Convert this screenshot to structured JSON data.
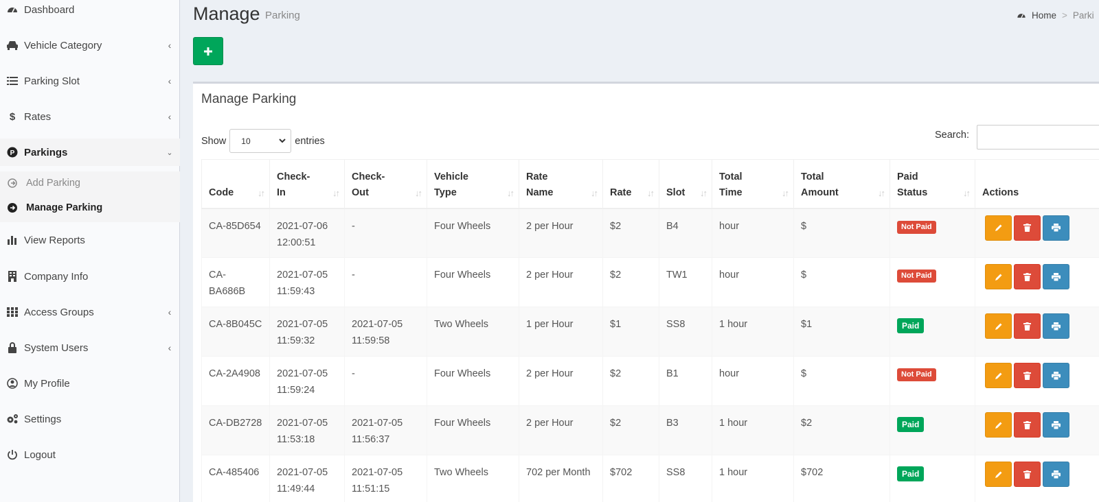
{
  "sidebar": {
    "items": [
      {
        "label": "Dashboard",
        "icon": "dashboard-icon"
      },
      {
        "label": "Vehicle Category",
        "icon": "car-icon"
      },
      {
        "label": "Parking Slot",
        "icon": "list-icon"
      },
      {
        "label": "Rates",
        "icon": "dollar-icon"
      },
      {
        "label": "Parkings",
        "icon": "parking-icon"
      },
      {
        "label": "View Reports",
        "icon": "bar-chart-icon"
      },
      {
        "label": "Company Info",
        "icon": "building-icon"
      },
      {
        "label": "Access Groups",
        "icon": "grid-icon"
      },
      {
        "label": "System Users",
        "icon": "lock-icon"
      },
      {
        "label": "My Profile",
        "icon": "user-circle-icon"
      },
      {
        "label": "Settings",
        "icon": "gears-icon"
      },
      {
        "label": "Logout",
        "icon": "power-icon"
      }
    ],
    "submenu": [
      {
        "label": "Add Parking"
      },
      {
        "label": "Manage Parking"
      }
    ]
  },
  "header": {
    "title": "Manage",
    "subtitle": "Parking",
    "breadcrumb": {
      "home": "Home",
      "separator": ">",
      "current": "Parki"
    }
  },
  "box": {
    "title": "Manage Parking",
    "show_label": "Show",
    "page_length": "10",
    "entries_label": "entries",
    "search_label": "Search:",
    "search_value": ""
  },
  "table": {
    "headers": [
      {
        "line1": "",
        "line2": "Code"
      },
      {
        "line1": "Check-",
        "line2": "In"
      },
      {
        "line1": "Check-",
        "line2": "Out"
      },
      {
        "line1": "Vehicle",
        "line2": "Type"
      },
      {
        "line1": "Rate",
        "line2": "Name"
      },
      {
        "line1": "",
        "line2": "Rate"
      },
      {
        "line1": "",
        "line2": "Slot"
      },
      {
        "line1": "Total",
        "line2": "Time"
      },
      {
        "line1": "Total",
        "line2": "Amount"
      },
      {
        "line1": "Paid",
        "line2": "Status"
      },
      {
        "line1": "",
        "line2": "Actions"
      }
    ],
    "rows": [
      {
        "code": "CA-85D654",
        "in1": "2021-07-06",
        "in2": "12:00:51",
        "out1": "-",
        "out2": "",
        "vehicle": "Four Wheels",
        "rate_name": "2 per Hour",
        "rate": "$2",
        "slot": "B4",
        "time": "hour",
        "amount": "$",
        "status": "Not Paid"
      },
      {
        "code": "CA-BA686B",
        "in1": "2021-07-05",
        "in2": "11:59:43",
        "out1": "-",
        "out2": "",
        "vehicle": "Four Wheels",
        "rate_name": "2 per Hour",
        "rate": "$2",
        "slot": "TW1",
        "time": "hour",
        "amount": "$",
        "status": "Not Paid"
      },
      {
        "code": "CA-8B045C",
        "in1": "2021-07-05",
        "in2": "11:59:32",
        "out1": "2021-07-05",
        "out2": "11:59:58",
        "vehicle": "Two Wheels",
        "rate_name": "1 per Hour",
        "rate": "$1",
        "slot": "SS8",
        "time": "1 hour",
        "amount": "$1",
        "status": "Paid"
      },
      {
        "code": "CA-2A4908",
        "in1": "2021-07-05",
        "in2": "11:59:24",
        "out1": "-",
        "out2": "",
        "vehicle": "Four Wheels",
        "rate_name": "2 per Hour",
        "rate": "$2",
        "slot": "B1",
        "time": "hour",
        "amount": "$",
        "status": "Not Paid"
      },
      {
        "code": "CA-DB2728",
        "in1": "2021-07-05",
        "in2": "11:53:18",
        "out1": "2021-07-05",
        "out2": "11:56:37",
        "vehicle": "Four Wheels",
        "rate_name": "2 per Hour",
        "rate": "$2",
        "slot": "B3",
        "time": "1 hour",
        "amount": "$2",
        "status": "Paid"
      },
      {
        "code": "CA-485406",
        "in1": "2021-07-05",
        "in2": "11:49:44",
        "out1": "2021-07-05",
        "out2": "11:51:15",
        "vehicle": "Two Wheels",
        "rate_name": "702 per Month",
        "rate": "$702",
        "slot": "SS8",
        "time": "1 hour",
        "amount": "$702",
        "status": "Paid"
      }
    ]
  },
  "colors": {
    "success": "#00a65a",
    "danger": "#dd4b39",
    "warning": "#f39c12",
    "primary": "#3c8dbc"
  }
}
